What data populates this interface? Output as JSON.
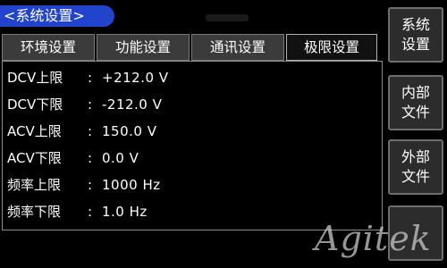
{
  "header": {
    "title": "<系统设置>"
  },
  "tabs": [
    {
      "label": "环境设置"
    },
    {
      "label": "功能设置"
    },
    {
      "label": "通讯设置"
    },
    {
      "label": "极限设置"
    }
  ],
  "settings": [
    {
      "label": "DCV上限",
      "value": "+212.0 V"
    },
    {
      "label": "DCV下限",
      "value": "-212.0 V"
    },
    {
      "label": "ACV上限",
      "value": "150.0 V"
    },
    {
      "label": "ACV下限",
      "value": "0.0 V"
    },
    {
      "label": "频率上限",
      "value": "1000 Hz"
    },
    {
      "label": "频率下限",
      "value": "1.0 Hz"
    }
  ],
  "separator": ":",
  "side_buttons": [
    {
      "line1": "系统",
      "line2": "设置"
    },
    {
      "line1": "内部",
      "line2": "文件"
    },
    {
      "line1": "外部",
      "line2": "文件"
    },
    {
      "line1": "",
      "line2": ""
    }
  ],
  "watermark": "Agitek",
  "colors": {
    "title_bg": "#2244cc",
    "tab_bg": "#3b3b3b",
    "button_bg": "#2c2c2c"
  }
}
